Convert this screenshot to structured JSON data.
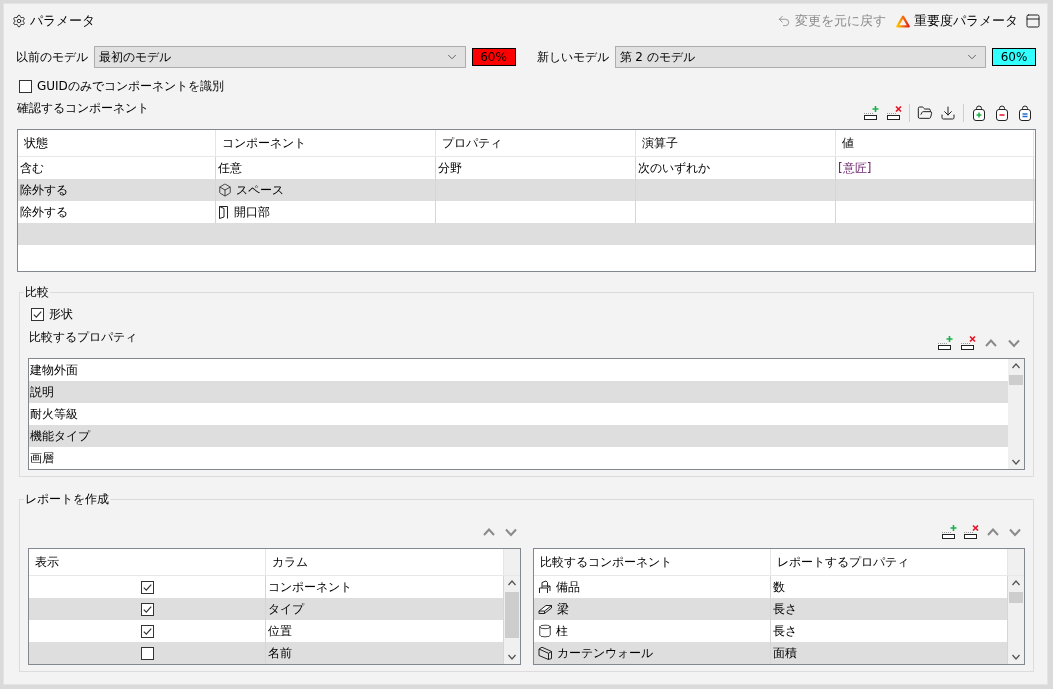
{
  "header": {
    "title": "パラメータ",
    "actions": [
      {
        "kind": "undo",
        "label": "変更を元に戻す",
        "disabled": true
      },
      {
        "kind": "importance",
        "label": "重要度パラメータ",
        "disabled": false
      }
    ]
  },
  "models": [
    {
      "label": "以前のモデル",
      "value": "最初のモデル",
      "badge": "60%",
      "color": "#ff0000"
    },
    {
      "label": "新しいモデル",
      "value": "第 2 のモデル",
      "badge": "60%",
      "color": "#33ffff"
    }
  ],
  "guid_only": {
    "label": "GUIDのみでコンポーネントを識別",
    "checked": false
  },
  "components_to_check": {
    "title": "確認するコンポーネント",
    "columns": [
      "状態",
      "コンポーネント",
      "プロパティ",
      "演算子",
      "値"
    ],
    "rows": [
      {
        "state": "含む",
        "kind": "any",
        "component": "任意",
        "property": "分野",
        "operator": "次のいずれか",
        "value": "[意匠]"
      },
      {
        "state": "除外する",
        "kind": "space",
        "component": "スペース"
      },
      {
        "state": "除外する",
        "kind": "opening",
        "component": "開口部"
      }
    ]
  },
  "comparison": {
    "title": "比較",
    "shape": {
      "label": "形状",
      "checked": true
    },
    "properties_title": "比較するプロパティ",
    "properties": [
      "建物外面",
      "説明",
      "耐火等級",
      "機能タイプ",
      "画層"
    ]
  },
  "report": {
    "title": "レポートを作成",
    "columns_table": {
      "columns": [
        "表示",
        "カラム"
      ],
      "rows": [
        {
          "label": "コンポーネント",
          "checked": true
        },
        {
          "label": "タイプ",
          "checked": true
        },
        {
          "label": "位置",
          "checked": true
        },
        {
          "label": "名前",
          "checked": false
        }
      ]
    },
    "components_table": {
      "columns": [
        "比較するコンポーネント",
        "レポートするプロパティ"
      ],
      "rows": [
        {
          "kind": "furniture",
          "component": "備品",
          "property": "数"
        },
        {
          "kind": "beam",
          "component": "梁",
          "property": "長さ"
        },
        {
          "kind": "column",
          "component": "柱",
          "property": "長さ"
        },
        {
          "kind": "curtain_wall",
          "component": "カーテンウォール",
          "property": "面積"
        }
      ]
    }
  }
}
